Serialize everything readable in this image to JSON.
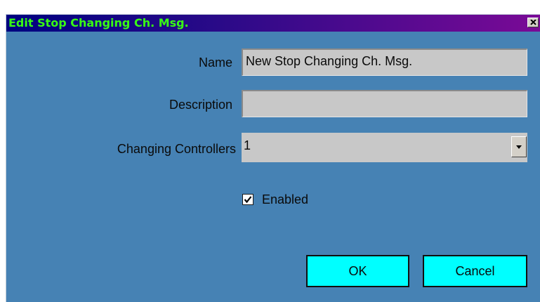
{
  "window": {
    "title": "Edit Stop Changing Ch. Msg."
  },
  "form": {
    "name_label": "Name",
    "name_value": "New Stop Changing Ch. Msg.",
    "description_label": "Description",
    "description_value": "",
    "controllers_label": "Changing Controllers",
    "controllers_value": "1",
    "enabled_label": "Enabled",
    "enabled_checked": true
  },
  "buttons": {
    "ok_label": "OK",
    "cancel_label": "Cancel"
  },
  "icons": {
    "close": "close-icon",
    "dropdown": "chevron-down-icon",
    "check": "checkmark-icon"
  },
  "colors": {
    "dialog_bg": "#4682b4",
    "title_text": "#39ff14",
    "button_bg": "#00ffff",
    "field_bg": "#c8c8c8"
  }
}
